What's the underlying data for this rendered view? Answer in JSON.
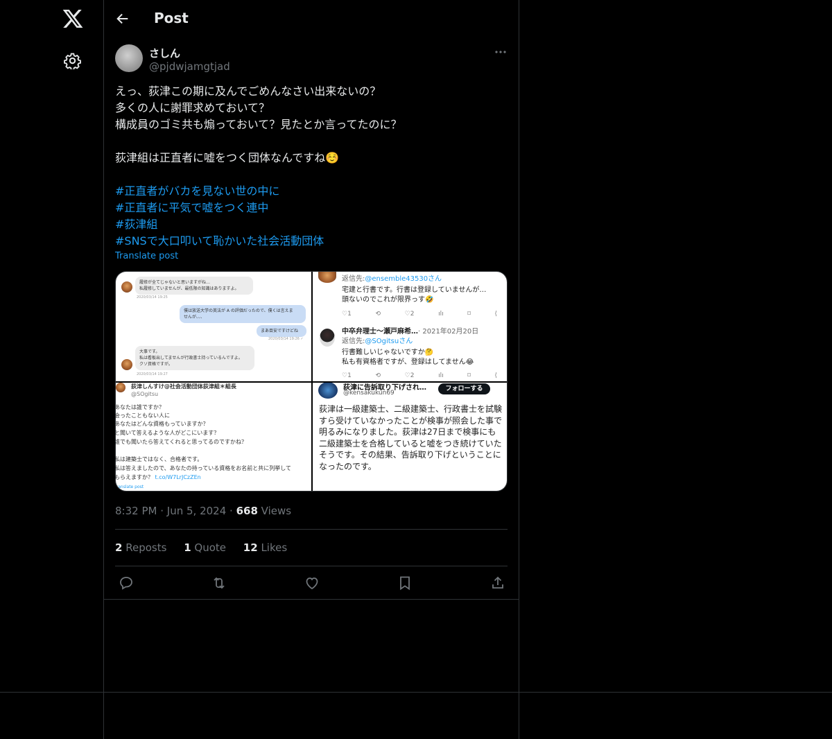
{
  "header": {
    "title": "Post"
  },
  "tweet": {
    "name": "さしん",
    "handle": "@pjdwjamgtjad",
    "text_lines": [
      "えっ、荻津この期に及んでごめんなさい出来ないの？",
      "多くの人に謝罪求めておいて？",
      "構成員のゴミ共も煽っておいて？見たとか言ってたのに？",
      "",
      "荻津組は正直者に嘘をつく団体なんですね☺️",
      ""
    ],
    "hashtags": [
      "#正直者がバカを見ない世の中に",
      "#正直者に平気で嘘をつく連中",
      "#荻津組",
      "#SNSで大口叩いて恥かいた社会活動団体"
    ],
    "translate": "Translate post",
    "time": "8:32 PM",
    "date": "Jun 5, 2024",
    "views_count": "668",
    "views_label": "Views",
    "reposts_count": "2",
    "reposts_label": "Reposts",
    "quotes_count": "1",
    "quotes_label": "Quote",
    "likes_count": "12",
    "likes_label": "Likes"
  },
  "media": {
    "tile1": {
      "b1a": "履修が全てじゃないと思いますがね…",
      "b1b": "私履修していませんが、最低限の知識はありますよ。",
      "ts1": "2020/03/14 19:25",
      "b2a": "僕は放送大学の英法が A の評価だったので、僕くは言えま",
      "b2b": "せんが、、、",
      "b3": "まあ目安ですけどね",
      "ts2": "2020/03/14 19:26 ✓",
      "b4a": "大事です。",
      "b4b": "私は看板出してませんが行政書士持っているんですよ。",
      "b4c": "クソ資格ですが。",
      "ts3": "2020/03/14 19:27"
    },
    "tile2": {
      "reply1_label": "返信先:",
      "reply1_to": "@ensemble43530さん",
      "text1a": "宅建と行書です。行書は登録していませんが…",
      "text1b": "頭ないのでこれが限界っす🤣",
      "acts1": [
        "♡1",
        "⟲",
        "♡2",
        "ılı",
        "⌑",
        "⟨"
      ],
      "name2": "中卒弁理士〜瀬戸麻希…",
      "date2": "· 2021年02月20日",
      "reply2_label": "返信先:",
      "reply2_to": "@SOgitsuさん",
      "text2a": "行書難しいじゃないですか🤔",
      "text2b": "私も有資格者ですが、登録はしてません😂"
    },
    "tile3": {
      "name": "荻津しんすけ@社会活動団体荻津組＊組長",
      "handle": "@SOgitsu",
      "lines": [
        "あなたは誰ですか？",
        "会ったこともない人に",
        "あなたはどんな資格もっていますか？",
        "と聞いて答えるような人がどこにいます？",
        "誰でも聞いたら答えてくれると思ってるのですかね？",
        "",
        "私は建築士ではなく、合格者です。",
        "私は答えましたので、あなたの持っている資格をお名前と共に列挙して",
        "もらえますか？"
      ],
      "link": "t.co/W7LrJCzZEn",
      "translate": "Translate post"
    },
    "tile4": {
      "name": "荻津に告訴取り下げされ…",
      "handle": "@kensakukun69",
      "follow": "フォローする",
      "body": "荻津は一級建築士、二級建築士、行政書士を試験すら受けていなかったことが検事が照会した事で明るみになりました。荻津は27日まで検事にも二級建築士を合格していると嘘をつき続けていたそうです。その結果、告訴取り下げということになったのです。"
    }
  },
  "colors": {
    "accent": "#1d9bf0",
    "bg": "#000000",
    "border": "#2f3336",
    "muted": "#71767b"
  }
}
